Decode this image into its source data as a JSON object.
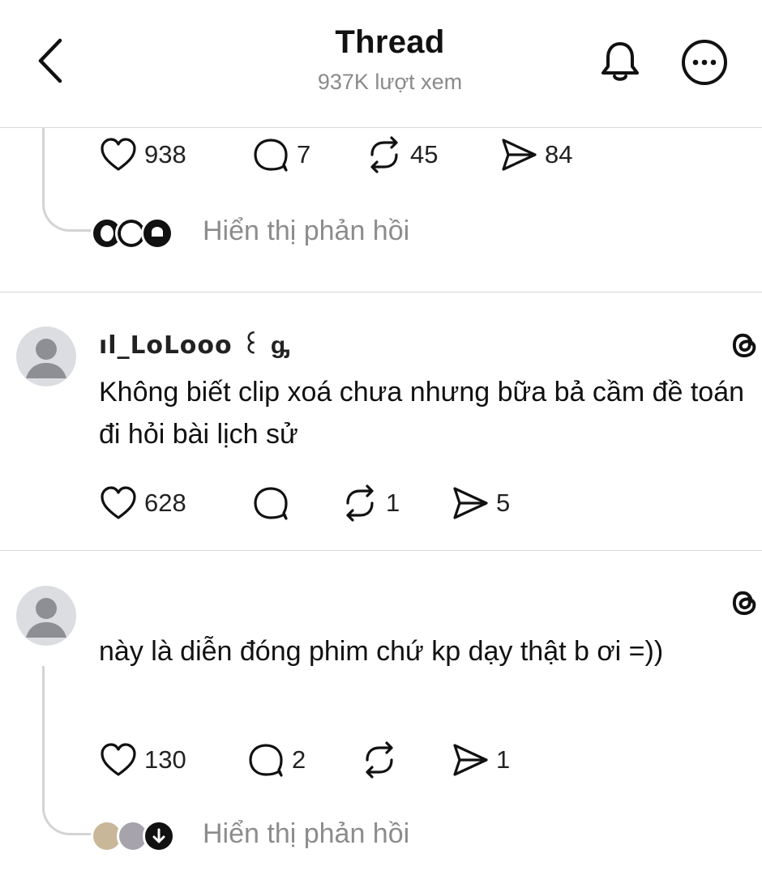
{
  "header": {
    "title": "Thread",
    "views": "937K lượt xem"
  },
  "post_top": {
    "likes": "938",
    "replies": "7",
    "reposts": "45",
    "shares": "84",
    "show_replies": "Hiển thị phản hồi"
  },
  "comment1": {
    "username": "ıl_ᒪoᒪooo ꒰ ᶃ",
    "text": "Không biết clip xoá chưa nhưng bữa bả cầm đề toán đi hỏi bài lịch sử",
    "likes": "628",
    "replies": "",
    "reposts": "1",
    "shares": "5"
  },
  "comment2": {
    "username": "",
    "text": "này là diễn đóng phim chứ kp dạy thật b ơi =))",
    "likes": "130",
    "replies": "2",
    "reposts": "",
    "shares": "1",
    "show_replies": "Hiển thị phản hồi"
  },
  "icons": [
    "back-chevron-icon",
    "bell-icon",
    "more-icon",
    "heart-icon",
    "comment-icon",
    "repost-icon",
    "share-icon",
    "threads-logo-icon",
    "default-avatar-icon"
  ],
  "colors": {
    "text": "#111111",
    "muted": "#8a8a8a",
    "divider": "#d8d8d8",
    "avatar_bg": "#dcdde1",
    "avatar_fg": "#8e8f95"
  }
}
